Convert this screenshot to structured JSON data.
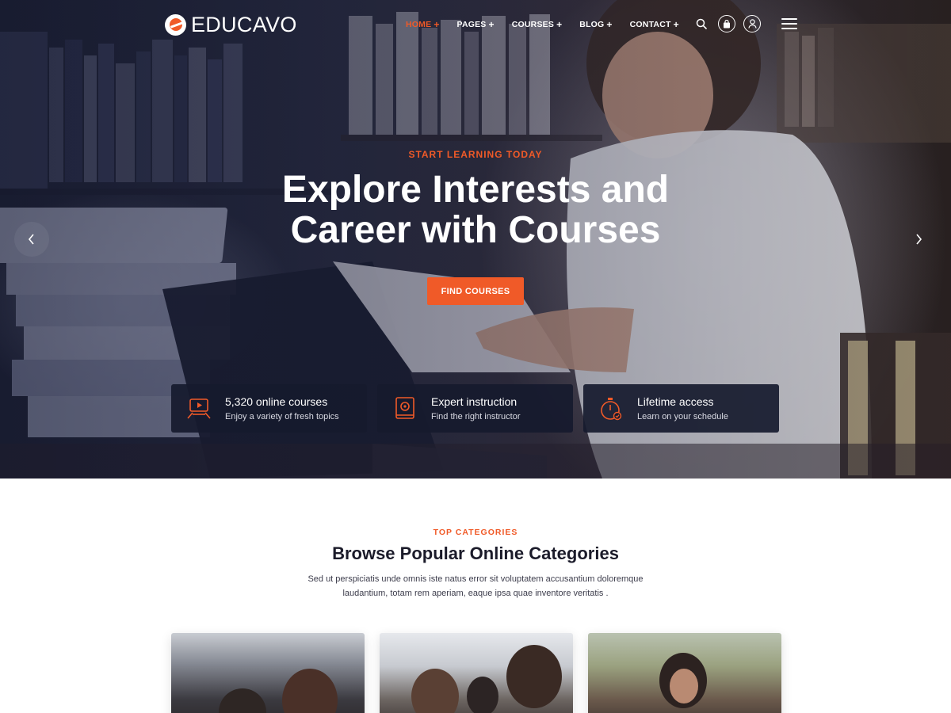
{
  "brand": {
    "name": "EDUCAVO",
    "accent": "#f05a28",
    "logo_icon": "educavo-logo-icon"
  },
  "nav": {
    "items": [
      {
        "label": "HOME",
        "active": true
      },
      {
        "label": "PAGES",
        "active": false
      },
      {
        "label": "COURSES",
        "active": false
      },
      {
        "label": "BLOG",
        "active": false
      },
      {
        "label": "CONTACT",
        "active": false
      }
    ],
    "icons": [
      "search-icon",
      "cart-icon",
      "user-icon",
      "menu-icon"
    ]
  },
  "hero": {
    "eyebrow": "START LEARNING TODAY",
    "title_line1": "Explore Interests and",
    "title_line2": "Career with Courses",
    "cta_label": "FIND COURSES",
    "prev_icon": "chevron-left-icon",
    "next_icon": "chevron-right-icon"
  },
  "features": [
    {
      "icon": "video-tutorial-icon",
      "title": "5,320 online courses",
      "subtitle": "Enjoy a variety of fresh topics"
    },
    {
      "icon": "expert-book-icon",
      "title": "Expert instruction",
      "subtitle": "Find the right instructor"
    },
    {
      "icon": "stopwatch-icon",
      "title": "Lifetime access",
      "subtitle": "Learn on your schedule"
    }
  ],
  "categories": {
    "eyebrow": "TOP CATEGORIES",
    "title": "Browse Popular Online Categories",
    "description_line1": "Sed ut perspiciatis unde omnis iste natus error sit voluptatem accusantium doloremque",
    "description_line2": "laudantium, totam rem aperiam, eaque ipsa quae inventore veritatis ."
  }
}
